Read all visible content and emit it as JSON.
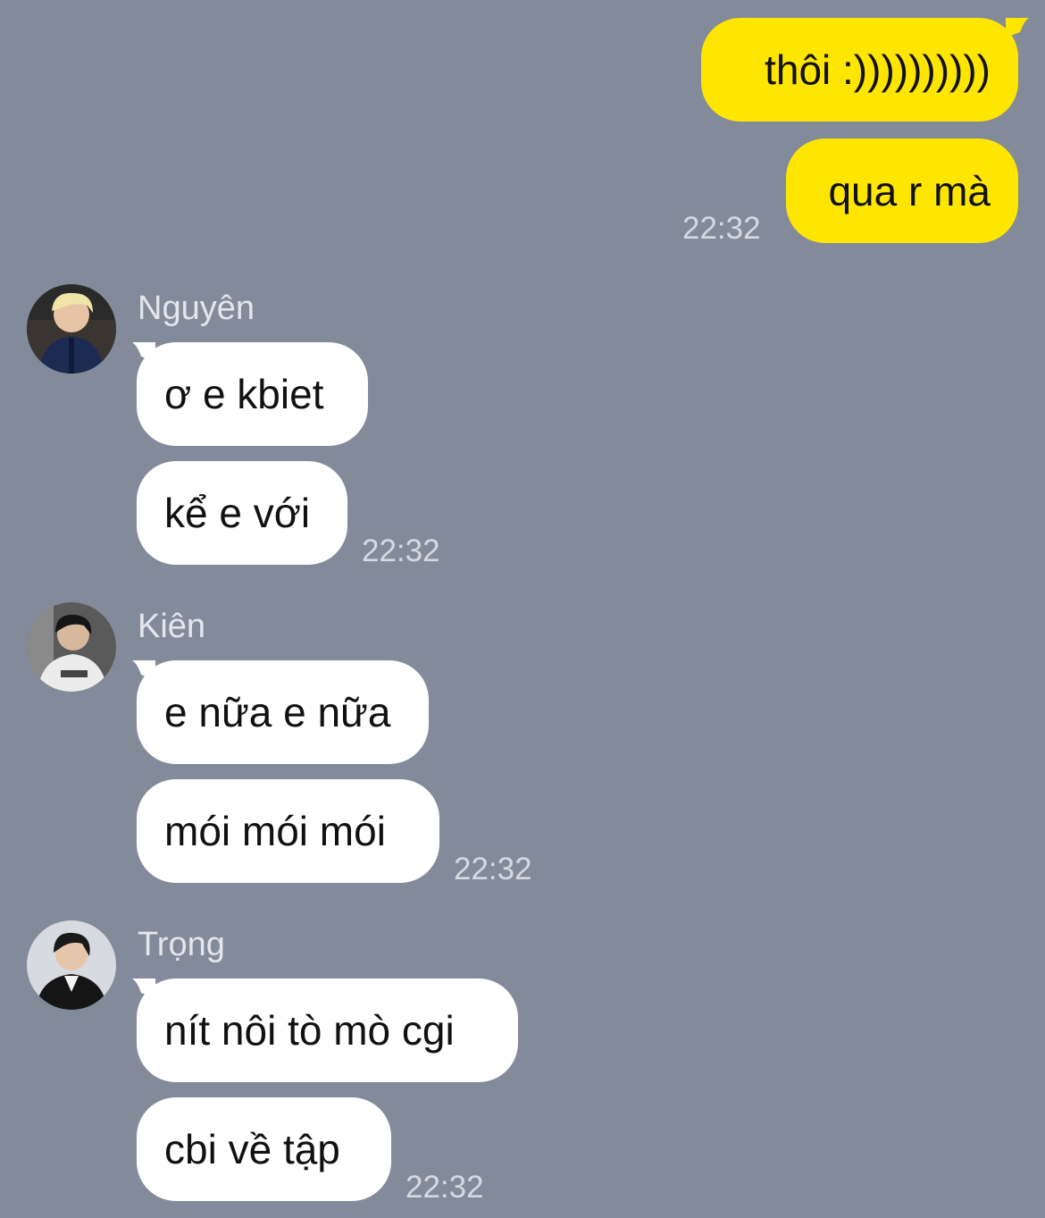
{
  "colors": {
    "background": "#838b9b",
    "my_bubble": "#ffe600",
    "their_bubble": "#ffffff",
    "timestamp": "#d6d9e0",
    "sender_name": "#e4e6eb"
  },
  "outgoing": {
    "messages": [
      "thôi :))))))))))",
      "qua r mà"
    ],
    "time": "22:32"
  },
  "groups": [
    {
      "sender": "Nguyên",
      "avatar_icon": "avatar-icon",
      "messages": [
        "ơ e kbiet",
        "kể e với"
      ],
      "time": "22:32"
    },
    {
      "sender": "Kiên",
      "avatar_icon": "avatar-icon",
      "messages": [
        "e nữa e nữa",
        "mói mói mói"
      ],
      "time": "22:32"
    },
    {
      "sender": "Trọng",
      "avatar_icon": "avatar-icon",
      "messages": [
        "nít nôi tò mò cgi",
        "cbi về tập"
      ],
      "time": "22:32"
    }
  ]
}
